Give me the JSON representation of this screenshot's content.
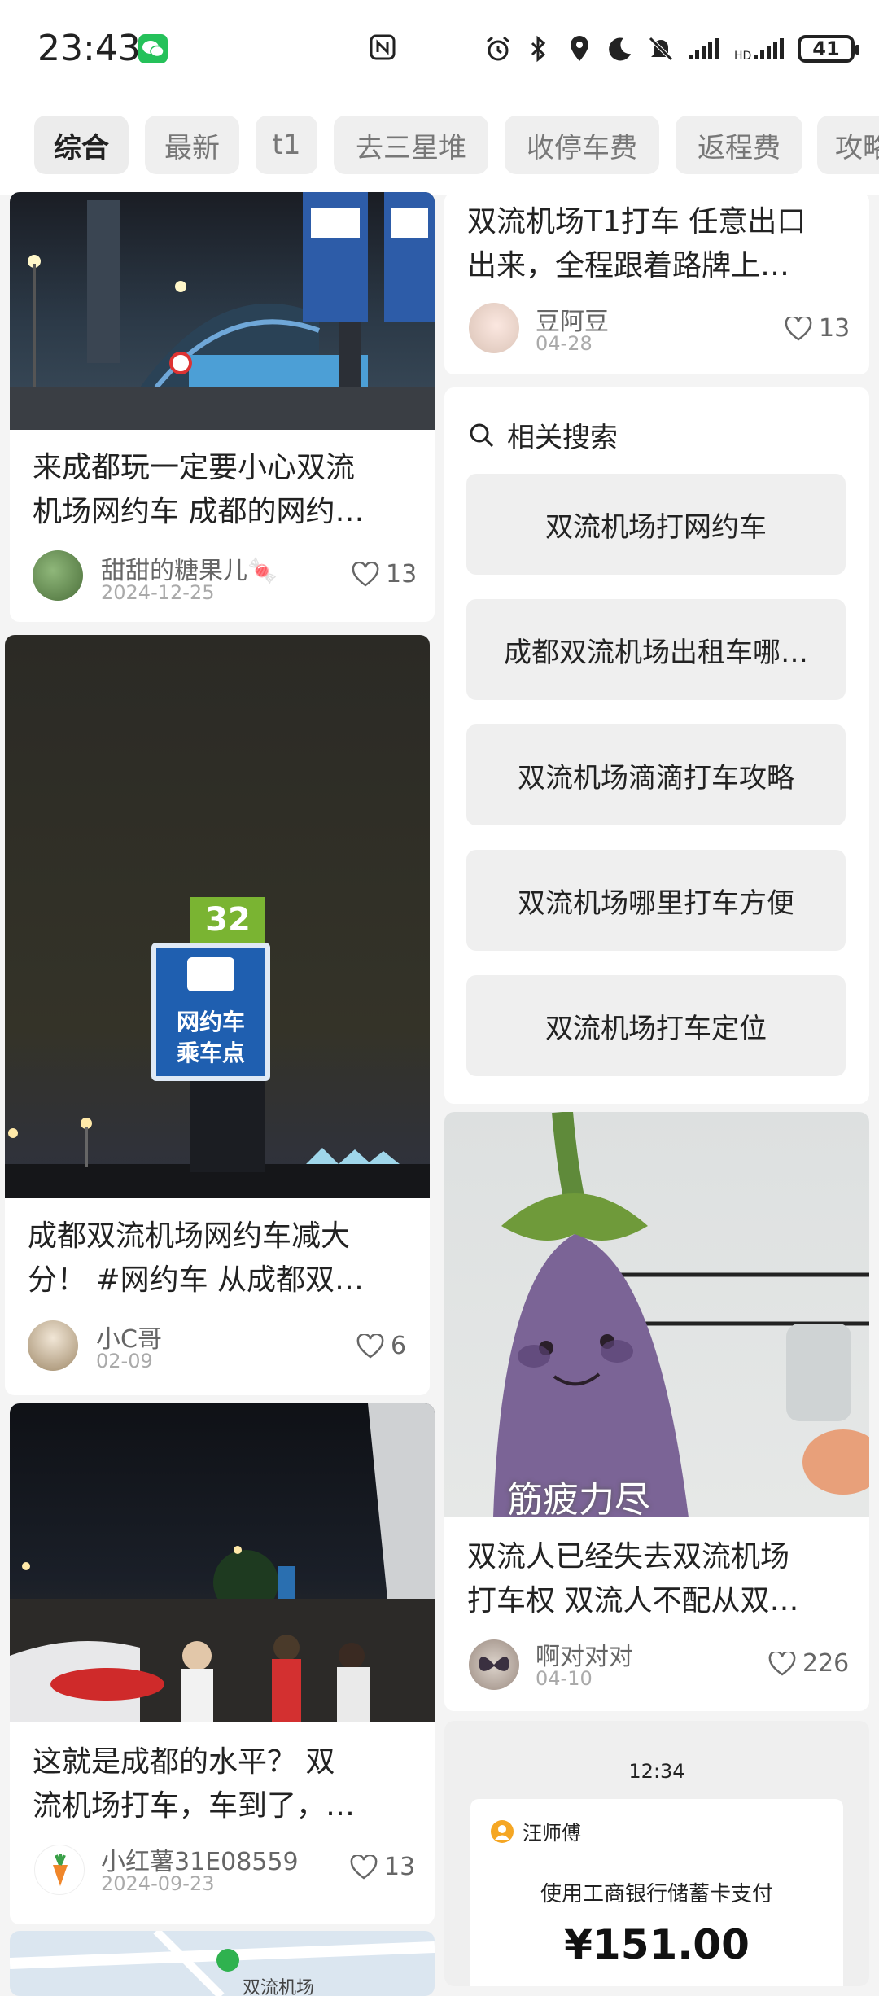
{
  "status_bar": {
    "time": "23:43",
    "battery": "41",
    "icons": [
      "wechat-icon",
      "nfc-icon",
      "alarm-icon",
      "bluetooth-icon",
      "location-icon",
      "moon-icon",
      "mute-icon",
      "signal-icon",
      "signal-icon",
      "battery-icon"
    ]
  },
  "tabs": [
    "综合",
    "最新",
    "t1",
    "去三星堆",
    "收停车费",
    "返程费",
    "攻略"
  ],
  "left_posts": [
    {
      "title_line1": "来成都玩一定要小心双流",
      "title_line2": "机场网约车 成都的网约…",
      "author": "甜甜的糖果儿🍬",
      "date": "2024-12-25",
      "likes": "13"
    },
    {
      "title_line1": "成都双流机场网约车减大",
      "title_line2": "分！ #网约车  从成都双…",
      "author": "小C哥",
      "date": "02-09",
      "likes": "6",
      "sign_line1": "网约车",
      "sign_line2": "乘车点",
      "sign_number": "32"
    },
    {
      "title_line1": "这就是成都的水平？ 双",
      "title_line2": "流机场打车，车到了，…",
      "author": "小红薯31E08559",
      "date": "2024-09-23",
      "likes": "13"
    }
  ],
  "right_posts": [
    {
      "title_line1": "双流机场T1打车 任意出口",
      "title_line2": "出来，全程跟着路牌上…",
      "author": "豆阿豆",
      "date": "04-28",
      "likes": "13"
    },
    {
      "title_line1": "双流人已经失去双流机场",
      "title_line2": "打车权 双流人不配从双…",
      "author": "啊对对对",
      "date": "04-10",
      "likes": "226",
      "image_caption": "筋疲力尽"
    }
  ],
  "related": {
    "heading": "相关搜索",
    "items": [
      "双流机场打网约车",
      "成都双流机场出租车哪…",
      "双流机场滴滴打车攻略",
      "双流机场哪里打车方便",
      "双流机场打车定位"
    ]
  },
  "receipt": {
    "time": "12:34",
    "driver": "汪师傅",
    "payment": "使用工商银行储蓄卡支付",
    "amount": "¥151.00"
  },
  "map_label": "双流机场",
  "colors": {
    "accent_green": "#25c15a",
    "sign_blue": "#1f5fb0",
    "sign_green": "#7ab432"
  }
}
